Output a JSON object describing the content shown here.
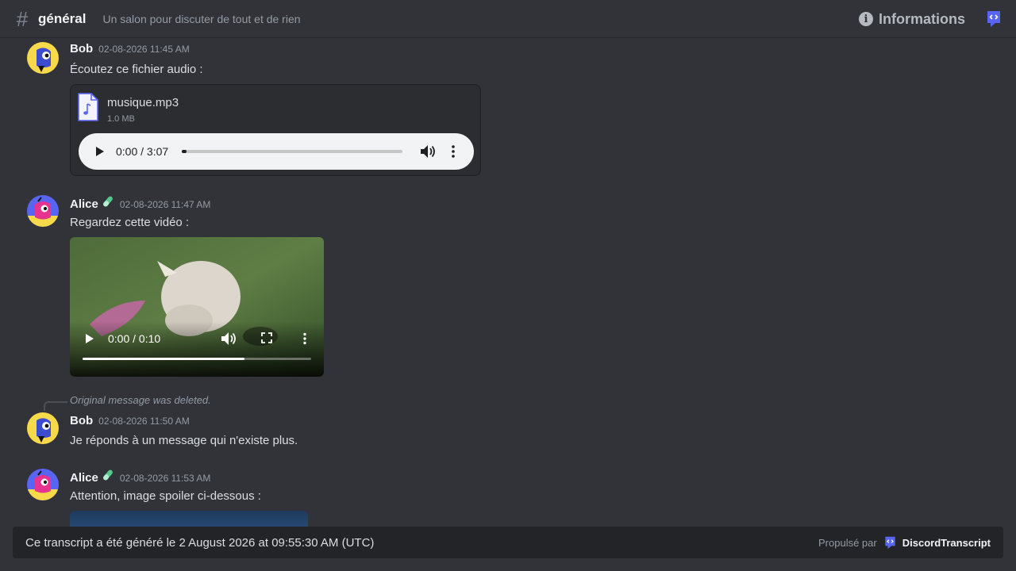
{
  "header": {
    "hash_glyph": "#",
    "channel_name": "général",
    "topic": "Un salon pour discuter de tout et de rien",
    "info_label": "Informations"
  },
  "messages": [
    {
      "author": "Bob",
      "timestamp": "02-08-2026 11:45 AM",
      "text": "Écoutez ce fichier audio :",
      "attachment": {
        "type": "audio",
        "file_name": "musique.mp3",
        "file_size": "1.0 MB",
        "time": "0:00 / 3:07",
        "progress": 0.02
      }
    },
    {
      "author": "Alice",
      "timestamp": "02-08-2026 11:47 AM",
      "text": "Regardez cette vidéo :",
      "attachment": {
        "type": "video",
        "time": "0:00 / 0:10",
        "progress": 0.71
      }
    },
    {
      "reply_to": "Original message was deleted.",
      "author": "Bob",
      "timestamp": "02-08-2026 11:50 AM",
      "text": "Je réponds à un message qui n'existe plus."
    },
    {
      "author": "Alice",
      "timestamp": "02-08-2026 11:53 AM",
      "text": "Attention, image spoiler ci-dessous :"
    }
  ],
  "footer": {
    "text": "Ce transcript a été généré le 2 August 2026 at 09:55:30 AM (UTC)",
    "powered_label": "Propulsé par",
    "brand_name": "DiscordTranscript"
  },
  "colors": {
    "background": "#313338",
    "brand": "#5865f2",
    "bob_avatar": "#f8d94a",
    "alice_avatar": "#5865f2",
    "alice_badge": "#57c78d"
  }
}
